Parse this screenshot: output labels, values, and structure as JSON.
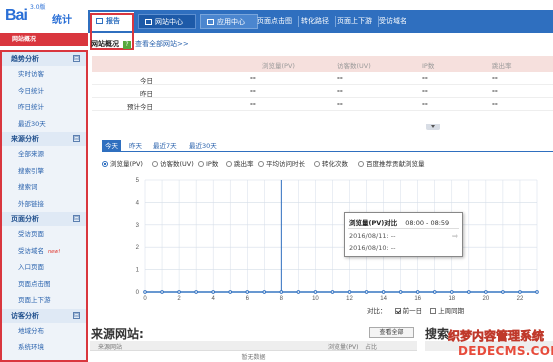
{
  "logo": {
    "brand": "Bai",
    "version": "3.0版",
    "suffix": "统计"
  },
  "topnav": {
    "tabs": [
      "报告",
      "网站中心",
      "应用中心",
      "页面点击图",
      "转化路径",
      "页面上下游",
      "受访域名"
    ]
  },
  "site_bar": {
    "label": "网站概况"
  },
  "sidebar": {
    "groups": [
      {
        "title": "趋势分析",
        "toggle": "⊟",
        "items": [
          "实时访客",
          "今日统计",
          "昨日统计",
          "最近30天"
        ]
      },
      {
        "title": "来源分析",
        "toggle": "⊟",
        "items": [
          "全部来源",
          "搜索引擎",
          "搜索词",
          "外部链接"
        ]
      },
      {
        "title": "页面分析",
        "toggle": "⊟",
        "items": [
          "受访页面",
          "受访域名",
          "入口页面",
          "页面点击图",
          "页面上下游"
        ]
      },
      {
        "title": "访客分析",
        "toggle": "⊟",
        "items": [
          "地域分布",
          "系统环境"
        ]
      }
    ],
    "new_badge": "new!"
  },
  "breadcrumb": {
    "title": "网站概况",
    "help": "?",
    "link": "查看全部网站>>"
  },
  "stats": {
    "columns": [
      "浏览量(PV)",
      "访客数(UV)",
      "IP数",
      "跳出率"
    ],
    "rows": [
      {
        "label": "今日",
        "values": [
          "--",
          "--",
          "--",
          "--"
        ]
      },
      {
        "label": "昨日",
        "values": [
          "--",
          "--",
          "--",
          "--"
        ]
      },
      {
        "label": "预计今日",
        "values": [
          "--",
          "--",
          "--",
          "--"
        ]
      }
    ]
  },
  "periods": {
    "tabs": [
      "今天",
      "昨天",
      "最近7天",
      "最近30天"
    ],
    "active": 0
  },
  "metrics": {
    "options": [
      "浏览量(PV)",
      "访客数(UV)",
      "IP数",
      "跳出率",
      "平均访问时长",
      "转化次数",
      "百度推荐贡献浏览量"
    ],
    "selected": 0
  },
  "chart_data": {
    "type": "line",
    "y_ticks": [
      "5",
      "4",
      "3",
      "2",
      "1",
      "0"
    ],
    "x_ticks": [
      "0",
      "2",
      "4",
      "6",
      "8",
      "10",
      "12",
      "14",
      "16",
      "18",
      "20",
      "22"
    ],
    "ylim": [
      0,
      5
    ],
    "x": [
      0,
      1,
      2,
      3,
      4,
      5,
      6,
      7,
      8,
      9,
      10,
      11,
      12,
      13,
      14,
      15,
      16,
      17,
      18,
      19,
      20,
      21,
      22,
      23
    ],
    "series": [
      {
        "values": [
          0,
          0,
          0,
          0,
          0,
          0,
          0,
          0,
          0,
          0,
          0,
          0,
          0,
          0,
          0,
          0,
          0,
          0,
          0,
          0,
          0,
          0,
          0,
          0
        ]
      },
      {
        "values": [
          0,
          0,
          0,
          0,
          0,
          0,
          0,
          0,
          0,
          0,
          0,
          0,
          0,
          0,
          0,
          0,
          0,
          0,
          0,
          0,
          0,
          0,
          0,
          0
        ]
      }
    ],
    "highlight_x": 8,
    "colors": {
      "line": "#2f6fbf",
      "grid": "#d5dde8"
    }
  },
  "tooltip": {
    "title": "浏览量(PV)对比",
    "time": "08:00 - 08:59",
    "rows": [
      "2016/08/11: --",
      "2016/08/10: --"
    ],
    "arrow": "⇨"
  },
  "compare": {
    "label": "对比：",
    "opt1": "前一日",
    "opt2": "上周同期",
    "opt1_checked": true
  },
  "sources": {
    "title": "来源网站:",
    "view_all": "查看全部",
    "columns": [
      "来源网站",
      "浏览量(PV)",
      "占比"
    ],
    "empty": "暂无数据"
  },
  "search_words": {
    "title": "搜索"
  },
  "watermark": {
    "line1": "织梦内容管理系统",
    "line2": "DEDECMS.COM"
  }
}
